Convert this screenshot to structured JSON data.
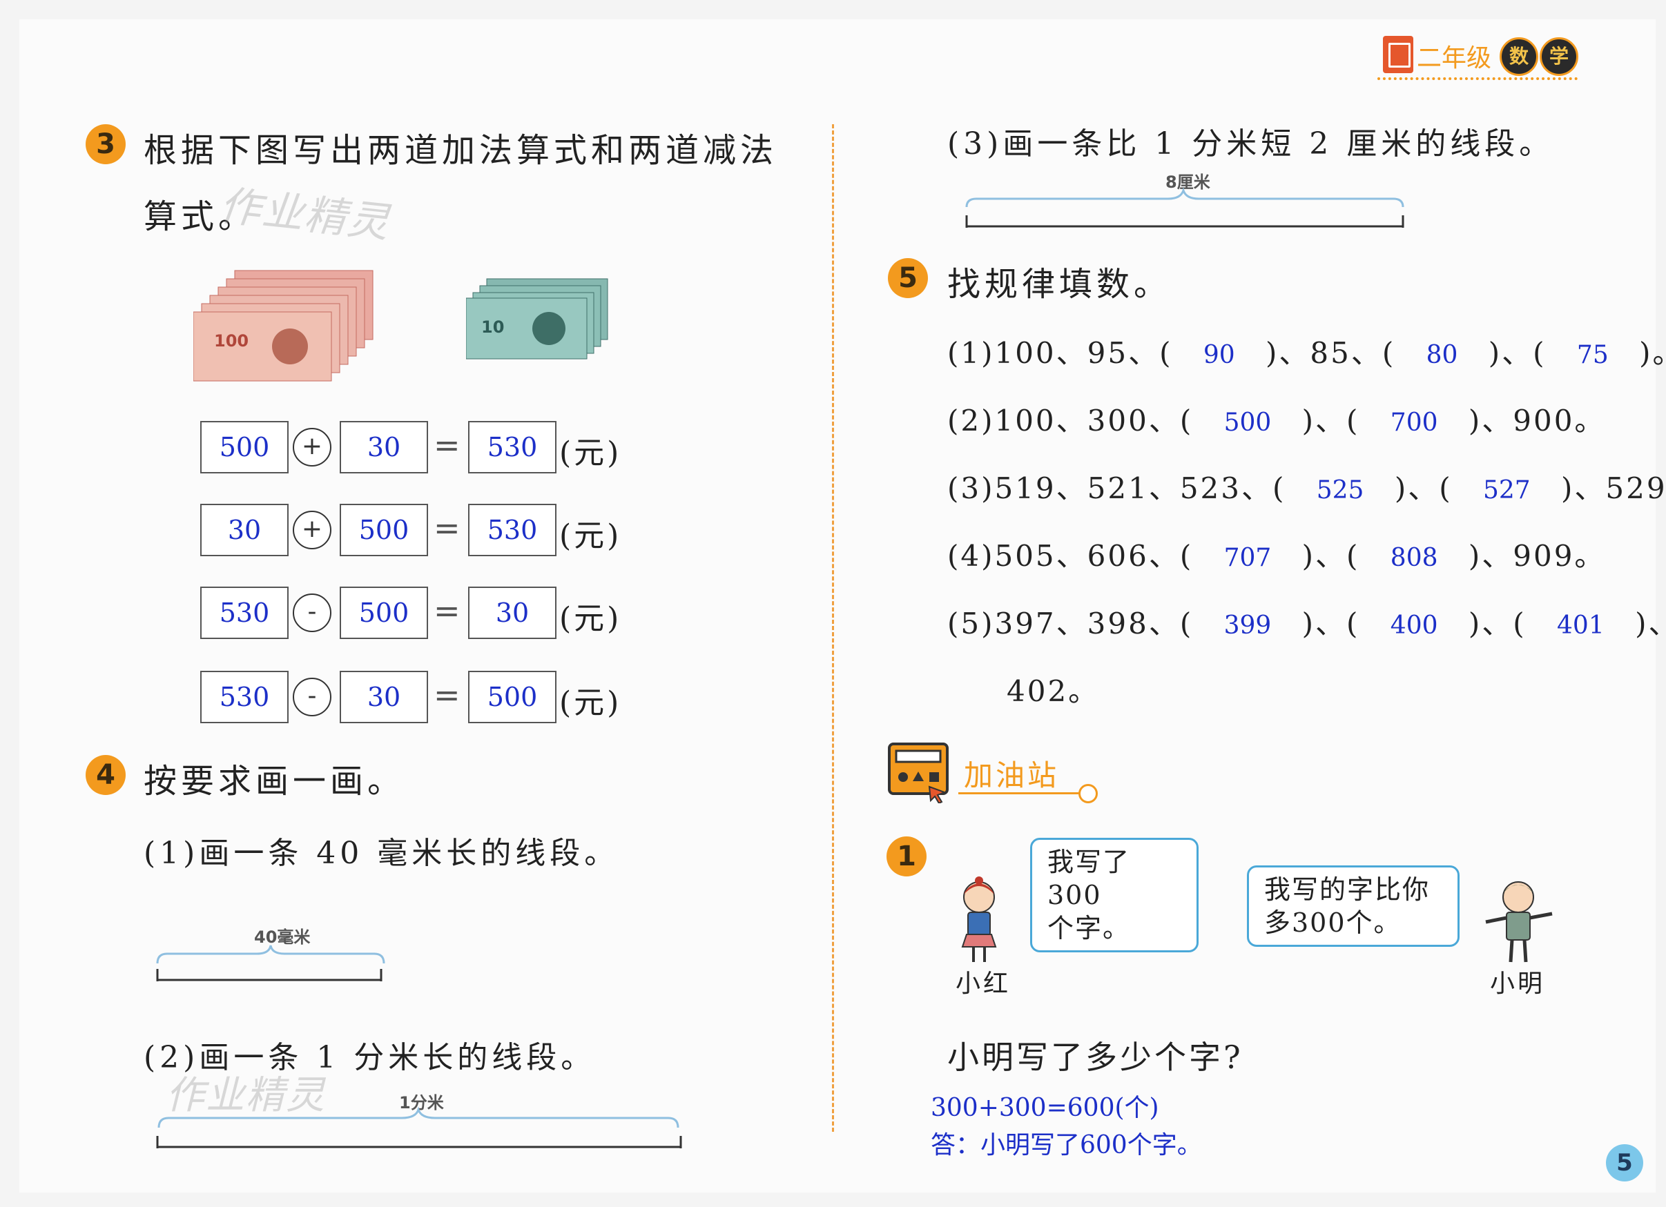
{
  "header": {
    "grade": "二年级",
    "subject_char1": "数",
    "subject_char2": "学"
  },
  "q3": {
    "number": "3",
    "text_line1": "根据下图写出两道加法算式和两道减法",
    "text_line2": "算式。",
    "watermark": "作业精灵",
    "equations": [
      {
        "a": "500",
        "op": "+",
        "b": "30",
        "eq": "=",
        "result": "530",
        "unit": "(元)"
      },
      {
        "a": "30",
        "op": "+",
        "b": "500",
        "eq": "=",
        "result": "530",
        "unit": "(元)"
      },
      {
        "a": "530",
        "op": "-",
        "b": "500",
        "eq": "=",
        "result": "30",
        "unit": "(元)"
      },
      {
        "a": "530",
        "op": "-",
        "b": "30",
        "eq": "=",
        "result": "500",
        "unit": "(元)"
      }
    ]
  },
  "q4": {
    "number": "4",
    "title": "按要求画一画。",
    "part1": "(1)画一条 40 毫米长的线段。",
    "part1_label": "40毫米",
    "part2": "(2)画一条 1 分米长的线段。",
    "part2_label": "1分米",
    "watermark": "作业精灵",
    "part3": "(3)画一条比 1 分米短 2 厘米的线段。",
    "part3_label": "8厘米"
  },
  "q5": {
    "number": "5",
    "title": "找规律填数。",
    "rows": [
      {
        "p1": "(1)100、95、(",
        "a1": "90",
        "p2": ")、85、(",
        "a2": "80",
        "p3": ")、(",
        "a3": "75",
        "p4": ")。"
      },
      {
        "p1": "(2)100、300、(",
        "a1": "500",
        "p2": ")、(",
        "a2": "700",
        "p3": ")、900。"
      },
      {
        "p1": "(3)519、521、523、(",
        "a1": "525",
        "p2": ")、(",
        "a2": "527",
        "p3": ")、529。"
      },
      {
        "p1": "(4)505、606、(",
        "a1": "707",
        "p2": ")、(",
        "a2": "808",
        "p3": ")、909。"
      },
      {
        "p1": "(5)397、398、(",
        "a1": "399",
        "p2": ")、(",
        "a2": "400",
        "p3": ")、(",
        "a3": "401",
        "p4": ")、"
      }
    ],
    "row5_cont": "402。"
  },
  "bonus": {
    "title": "加油站",
    "number": "1",
    "girl_speech_l1": "我写了300",
    "girl_speech_l2": "个字。",
    "boy_speech_l1": "我写的字比你",
    "boy_speech_l2": "多300个。",
    "girl_name": "小红",
    "boy_name": "小明",
    "question": "小明写了多少个字?",
    "solution": "300+300=600(个)",
    "answer": "答：小明写了600个字。"
  },
  "page_number": "5",
  "colors": {
    "accent": "#f39a1e",
    "answer_blue": "#1c2fc8",
    "bubble_border": "#4aa8d8"
  }
}
